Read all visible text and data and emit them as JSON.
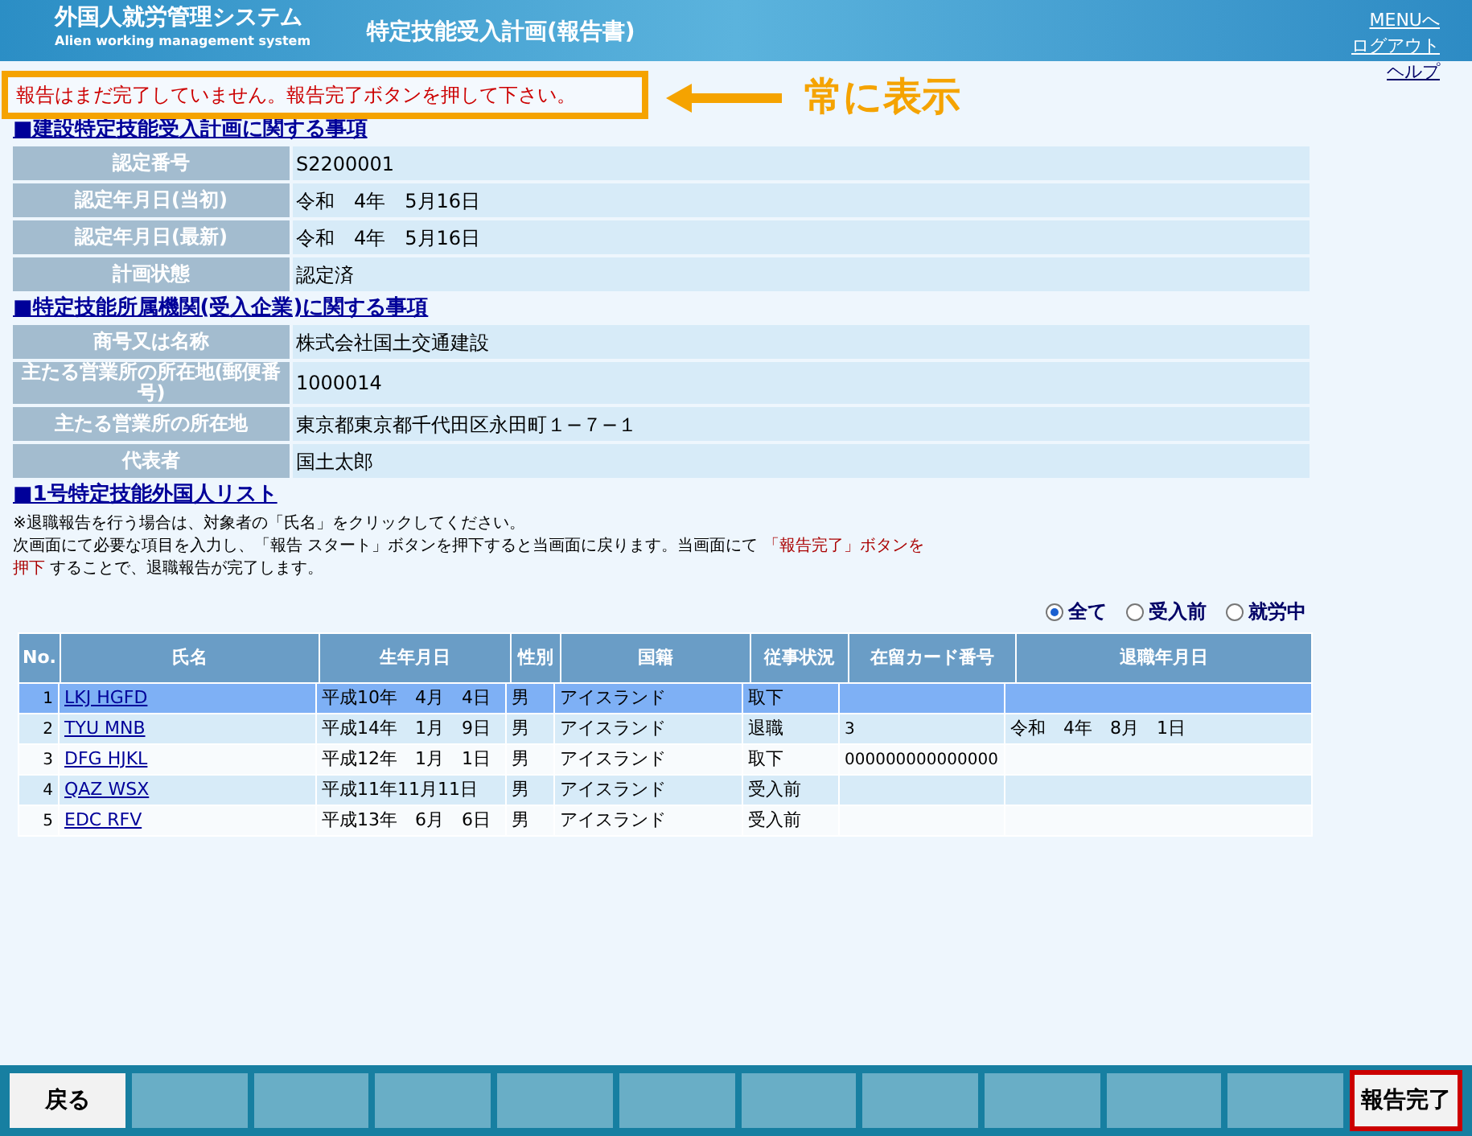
{
  "header": {
    "system_name": "外国人就労管理システム",
    "system_subtitle": "Alien working management system",
    "page_title": "特定技能受入計画(報告書)",
    "links": [
      "MENUへ",
      "ログアウト",
      "ヘルプ"
    ]
  },
  "annotation": {
    "message": "報告はまだ完了していません。報告完了ボタンを押して下さい。",
    "callout": "常に表示"
  },
  "sections": [
    {
      "title": "■建設特定技能受入計画に関する事項",
      "rows": [
        {
          "label": "認定番号",
          "value": "S2200001"
        },
        {
          "label": "認定年月日(当初)",
          "value": "令和　4年　5月16日"
        },
        {
          "label": "認定年月日(最新)",
          "value": "令和　4年　5月16日"
        },
        {
          "label": "計画状態",
          "value": "認定済"
        }
      ]
    },
    {
      "title": "■特定技能所属機関(受入企業)に関する事項",
      "rows": [
        {
          "label": "商号又は名称",
          "value": "株式会社国土交通建設"
        },
        {
          "label": "主たる営業所の所在地(郵便番号)",
          "value": "1000014"
        },
        {
          "label": "主たる営業所の所在地",
          "value": "東京都東京都千代田区永田町１−７−１"
        },
        {
          "label": "代表者",
          "value": "国土太郎"
        }
      ]
    }
  ],
  "list": {
    "title": "■1号特定技能外国人リスト",
    "note1": "※退職報告を行う場合は、対象者の「氏名」をクリックしてください。",
    "note2": "次画面にて必要な項目を入力し、「報告 スタート」ボタンを押下すると当画面に戻ります。当画面にて **「報告完了」ボタンを押下** することで、退職報告が完了します。",
    "filters": [
      {
        "label": "全て",
        "selected": true
      },
      {
        "label": "受入前",
        "selected": false
      },
      {
        "label": "就労中",
        "selected": false
      }
    ],
    "columns": [
      "No.",
      "氏名",
      "生年月日",
      "性別",
      "国籍",
      "従事状況",
      "在留カード番号",
      "退職年月日"
    ],
    "rows": [
      {
        "no": "1",
        "name": "LKJ HGFD",
        "birth": "平成10年　4月　4日",
        "sex": "男",
        "nationality": "アイスランド",
        "status": "取下",
        "selected": true
      },
      {
        "no": "2",
        "name": "TYU MNB",
        "birth": "平成14年　1月　9日",
        "sex": "男",
        "nationality": "アイスランド",
        "status": "退職",
        "card": "3",
        "retired": "令和　4年　8月　1日",
        "selected": false
      },
      {
        "no": "3",
        "name": "DFG HJKL",
        "birth": "平成12年　1月　1日",
        "sex": "男",
        "nationality": "アイスランド",
        "status": "取下",
        "card": "000000000000000",
        "selected": false
      },
      {
        "no": "4",
        "name": "QAZ WSX",
        "birth": "平成11年11月11日",
        "sex": "男",
        "nationality": "アイスランド",
        "status": "受入前",
        "selected": false
      },
      {
        "no": "5",
        "name": "EDC RFV",
        "birth": "平成13年　6月　6日",
        "sex": "男",
        "nationality": "アイスランド",
        "status": "受入前",
        "selected": false
      }
    ]
  },
  "footer": {
    "back": "戻る",
    "complete": "報告完了"
  }
}
